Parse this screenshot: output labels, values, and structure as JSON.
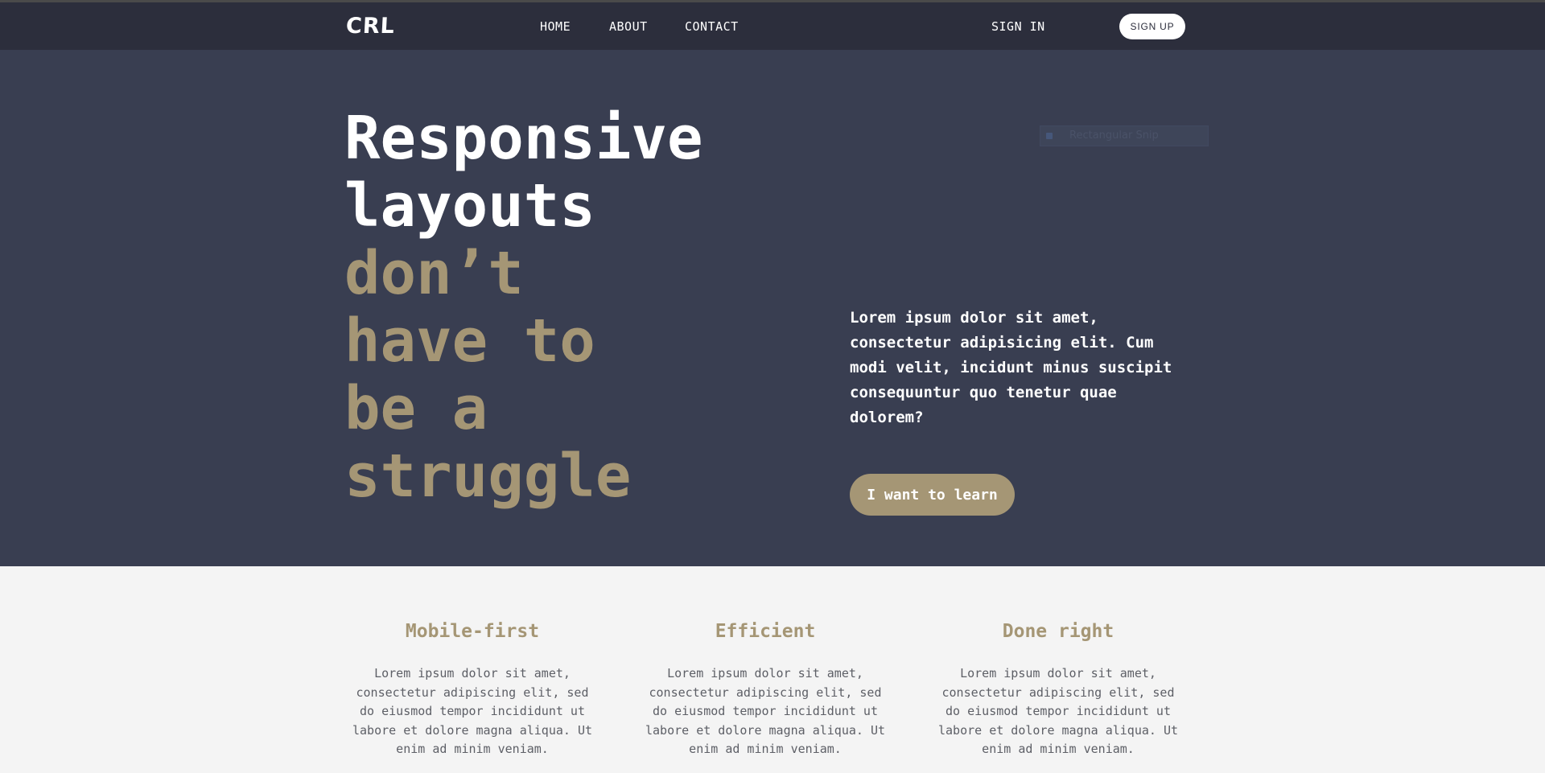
{
  "nav": {
    "logo": "CRL",
    "links": [
      "HOME",
      "ABOUT",
      "CONTACT"
    ],
    "sign_in": "SIGN IN",
    "sign_up": "SIGN UP"
  },
  "hero": {
    "title_line1": "Responsive",
    "title_line2": "layouts",
    "accent_line1": "don’t",
    "accent_line2": "have to",
    "accent_line3": "be a",
    "accent_line4": "struggle",
    "description": "Lorem ipsum dolor sit amet, consectetur adipisicing elit. Cum modi velit, incidunt minus suscipit consequuntur quo tenetur quae dolorem?",
    "cta": "I want to learn",
    "overlay_text": "Rectangular Snip"
  },
  "features": [
    {
      "title": "Mobile-first",
      "text": "Lorem ipsum dolor sit amet, consectetur adipiscing elit, sed do eiusmod tempor incididunt ut labore et dolore magna aliqua. Ut enim ad minim veniam."
    },
    {
      "title": "Efficient",
      "text": "Lorem ipsum dolor sit amet, consectetur adipiscing elit, sed do eiusmod tempor incididunt ut labore et dolore magna aliqua. Ut enim ad minim veniam."
    },
    {
      "title": "Done right",
      "text": "Lorem ipsum dolor sit amet, consectetur adipiscing elit, sed do eiusmod tempor incididunt ut labore et dolore magna aliqua. Ut enim ad minim veniam."
    }
  ],
  "colors": {
    "nav_bg": "#2c2e3c",
    "hero_bg": "#393e51",
    "accent": "#a59675",
    "features_bg": "#f4f4f4"
  }
}
